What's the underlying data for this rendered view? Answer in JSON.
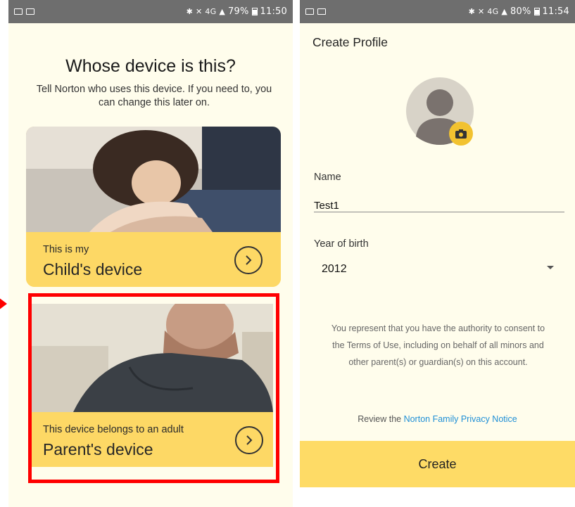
{
  "left_screen": {
    "status": {
      "battery": "79%",
      "time": "11:50",
      "signal_text": "4G"
    },
    "title": "Whose device is this?",
    "subtitle": "Tell Norton who uses this device. If you need to, you can change this later on.",
    "child_card": {
      "small": "This is my",
      "big": "Child's device"
    },
    "parent_card": {
      "small": "This device belongs to an adult",
      "big": "Parent's device"
    }
  },
  "right_screen": {
    "status": {
      "battery": "80%",
      "time": "11:54",
      "signal_text": "4G"
    },
    "title": "Create Profile",
    "name_label": "Name",
    "name_value": "Test1",
    "year_label": "Year of birth",
    "year_value": "2012",
    "legal_text": "You represent that you have the authority to consent to the Terms of Use, including on behalf of all minors and other parent(s) or guardian(s) on this account.",
    "review_prefix": "Review the ",
    "review_link": "Norton Family Privacy Notice",
    "create_label": "Create"
  },
  "colors": {
    "accent_yellow": "#fdd865",
    "highlight_red": "#ff0000",
    "link_blue": "#1f8fd6",
    "background_cream": "#fffdec"
  }
}
